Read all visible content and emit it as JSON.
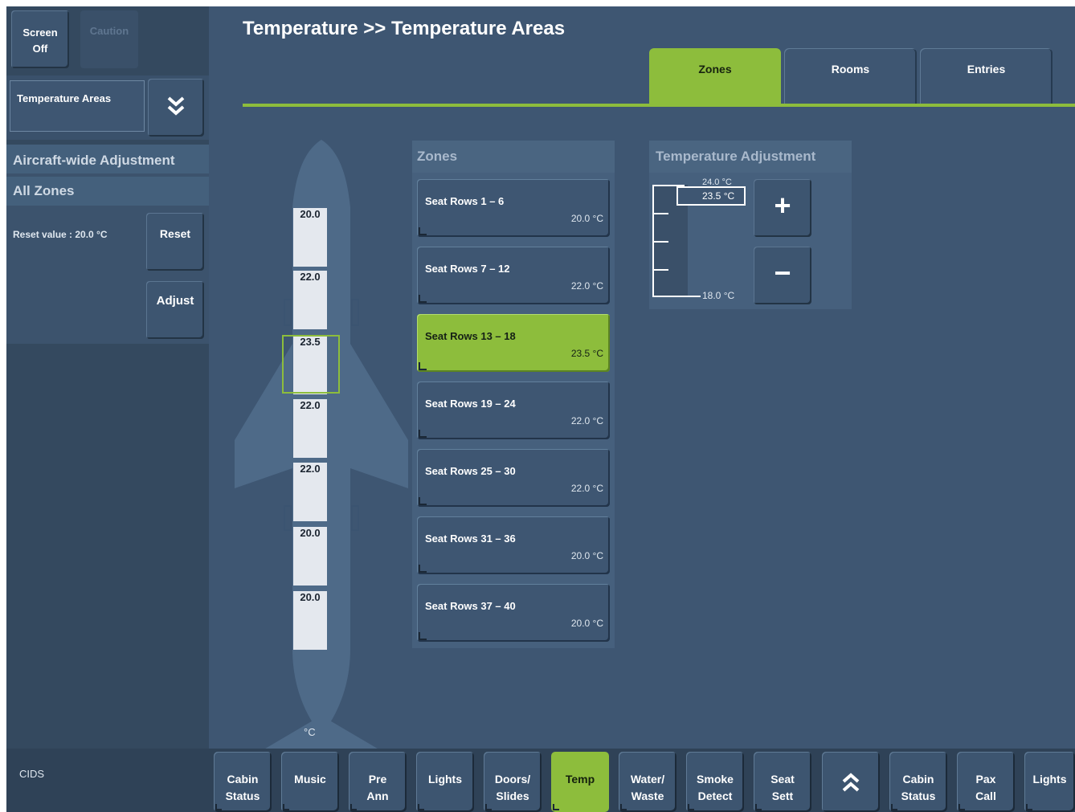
{
  "header": {
    "title": "Temperature >> Temperature Areas"
  },
  "tabs": [
    {
      "label": "Zones",
      "active": true
    },
    {
      "label": "Rooms",
      "active": false
    },
    {
      "label": "Entries",
      "active": false
    }
  ],
  "sidebar": {
    "screen_off": [
      "Screen",
      "Off"
    ],
    "caution": "Caution",
    "page_select": "Temperature Areas",
    "section_title": "Aircraft-wide Adjustment",
    "subsection_title": "All Zones",
    "reset_value_text": "Reset value : 20.0 °C",
    "reset_label": "Reset",
    "adjust_label": "Adjust",
    "footer_label": "CIDS"
  },
  "cabin_map": {
    "unit": "°C",
    "values": [
      "20.0",
      "22.0",
      "23.5",
      "22.0",
      "22.0",
      "20.0",
      "20.0"
    ],
    "selected_index": 2
  },
  "zones_panel": {
    "title": "Zones",
    "items": [
      {
        "label": "Seat Rows 1 – 6",
        "value": "20.0 °C"
      },
      {
        "label": "Seat Rows 7 – 12",
        "value": "22.0 °C"
      },
      {
        "label": "Seat Rows 13 – 18",
        "value": "23.5 °C",
        "selected": true
      },
      {
        "label": "Seat Rows 19 – 24",
        "value": "22.0 °C"
      },
      {
        "label": "Seat Rows 25 – 30",
        "value": "22.0 °C"
      },
      {
        "label": "Seat Rows 31 – 36",
        "value": "20.0 °C"
      },
      {
        "label": "Seat Rows 37 – 40",
        "value": "20.0 °C"
      }
    ]
  },
  "temp_adjust": {
    "title": "Temperature Adjustment",
    "max_label": "24.0 °C",
    "current_label": "23.5 °C",
    "min_label": "18.0 °C",
    "plus": "+",
    "minus": "−"
  },
  "bottom_nav": [
    {
      "lines": [
        "Cabin",
        "Status"
      ]
    },
    {
      "lines": [
        "Music"
      ]
    },
    {
      "lines": [
        "Pre",
        "Ann"
      ]
    },
    {
      "lines": [
        "Lights"
      ]
    },
    {
      "lines": [
        "Doors/",
        "Slides"
      ]
    },
    {
      "lines": [
        "Temp"
      ],
      "active": true
    },
    {
      "lines": [
        "Water/",
        "Waste"
      ]
    },
    {
      "lines": [
        "Smoke",
        "Detect"
      ]
    },
    {
      "lines": [
        "Seat",
        "Sett"
      ]
    },
    {
      "lines": [
        "Cabin",
        "Status"
      ]
    },
    {
      "lines": [
        "Pax",
        "Call"
      ]
    },
    {
      "lines": [
        "Lights"
      ]
    }
  ],
  "colors": {
    "accent": "#8dbd3c",
    "background": "#3e5672",
    "panel": "#46607d"
  }
}
